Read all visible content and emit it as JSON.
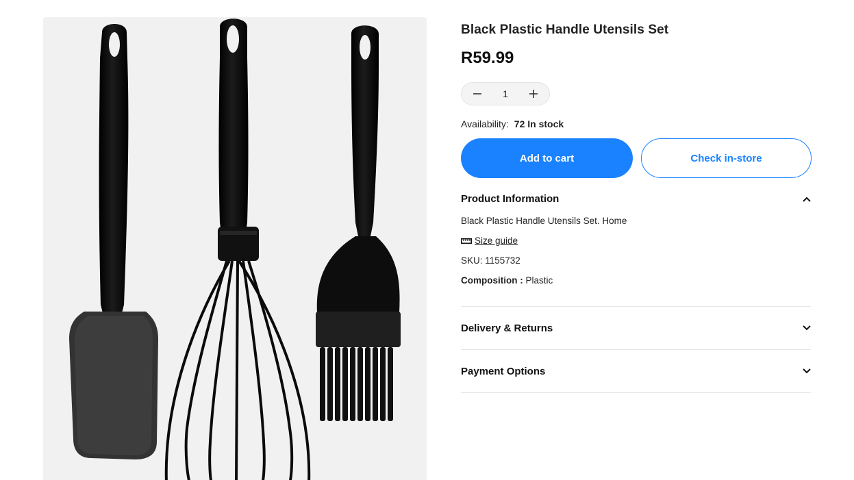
{
  "product": {
    "title": "Black Plastic Handle Utensils Set",
    "price": "R59.99",
    "image_alt": "Black plastic spatula, whisk and basting brush"
  },
  "quantity": {
    "value": "1",
    "decrease_icon": "minus-icon",
    "increase_icon": "plus-icon"
  },
  "availability": {
    "label": "Availability:",
    "value": "72 In stock"
  },
  "buttons": {
    "add_to_cart": "Add to cart",
    "check_in_store": "Check in-store"
  },
  "accordion": {
    "product_info": {
      "title": "Product Information",
      "description": "Black Plastic Handle Utensils Set. Home",
      "size_guide": "Size guide",
      "sku": "SKU: 1155732",
      "composition_label": "Composition :",
      "composition_value": "Plastic"
    },
    "delivery": {
      "title": "Delivery & Returns"
    },
    "payment": {
      "title": "Payment Options"
    }
  },
  "colors": {
    "accent": "#1a82ff",
    "image_bg": "#f1f1f1",
    "utensil": "#0b0b0b"
  }
}
